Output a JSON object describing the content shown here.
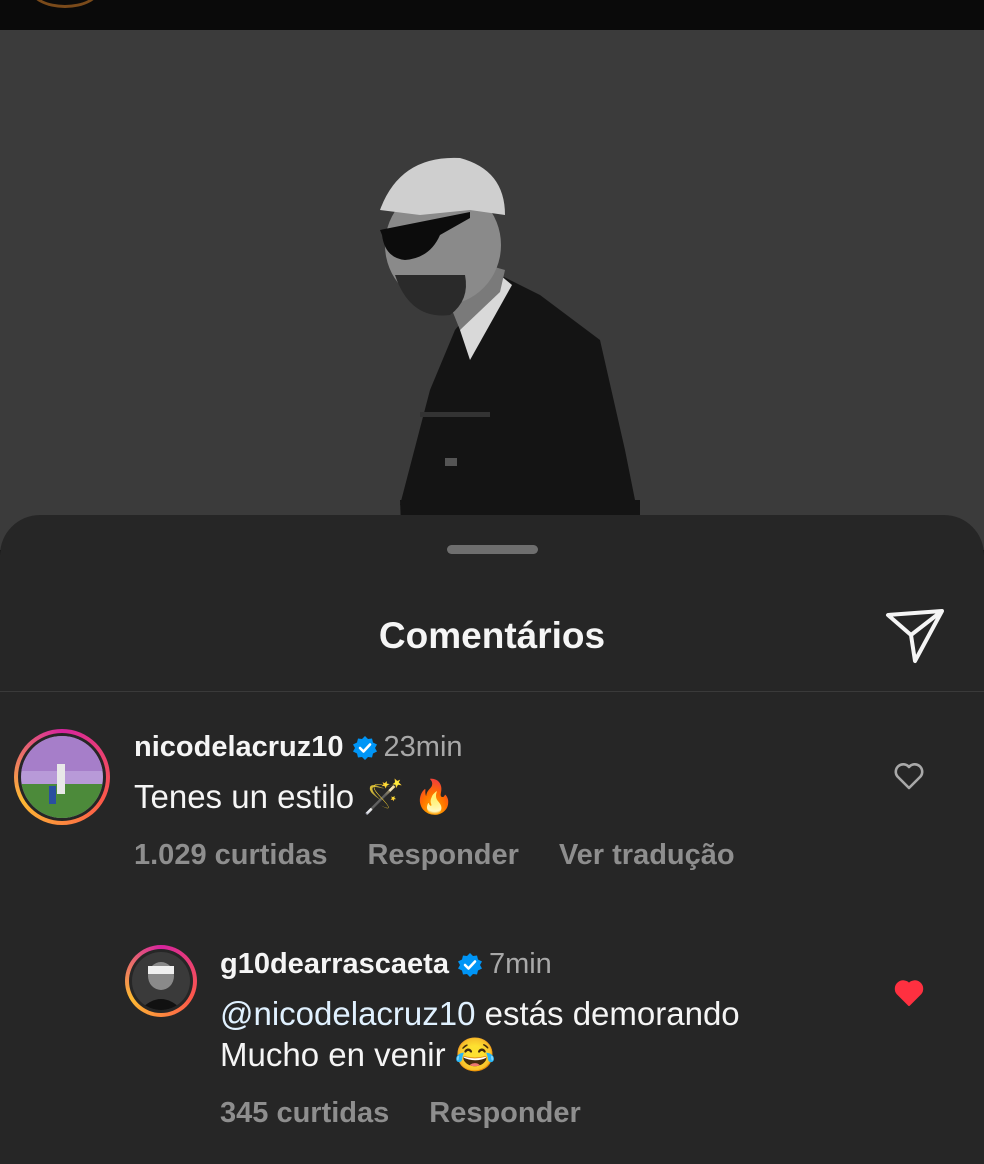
{
  "colors": {
    "sheet_bg": "#262626",
    "text": "#f5f5f5",
    "muted": "#8e8e8e",
    "verified": "#0095f6",
    "liked": "#ff3040"
  },
  "sheet": {
    "title": "Comentários"
  },
  "icons": {
    "share": "paper-plane-icon",
    "verified": "verified-badge-icon",
    "like": "heart-outline-icon",
    "liked": "heart-filled-icon"
  },
  "comments": [
    {
      "username": "nicodelacruz10",
      "time": "23min",
      "text": "Tenes un estilo 🪄 🔥",
      "likes": "1.029 curtidas",
      "reply": "Responder",
      "translate": "Ver tradução",
      "liked": false
    },
    {
      "username": "g10dearrascaeta",
      "time": "7min",
      "mention": "@nicodelacruz10",
      "text": " estás demorando Mucho en venir 😂",
      "likes": "345 curtidas",
      "reply": "Responder",
      "liked": true
    }
  ]
}
